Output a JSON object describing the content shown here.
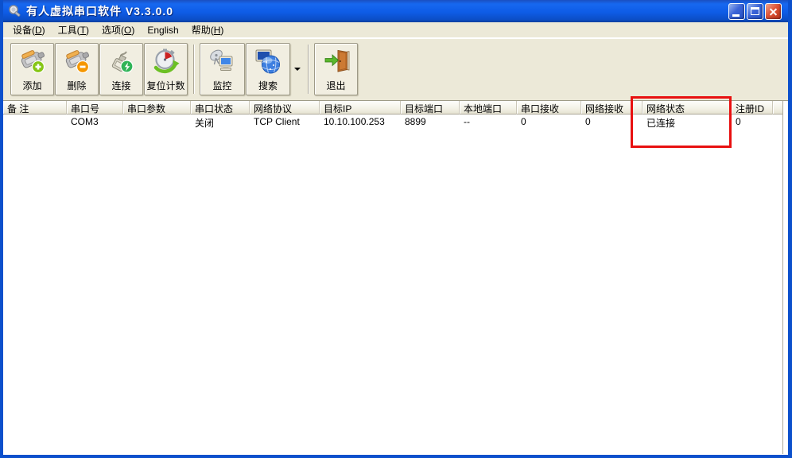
{
  "window": {
    "title": "有人虚拟串口软件 V3.3.0.0"
  },
  "menu": {
    "items": [
      {
        "pre": "设备(",
        "key": "D",
        "post": ")"
      },
      {
        "pre": "工具(",
        "key": "T",
        "post": ")"
      },
      {
        "pre": "选项(",
        "key": "O",
        "post": ")"
      },
      {
        "pre": "English",
        "key": "",
        "post": ""
      },
      {
        "pre": "帮助(",
        "key": "H",
        "post": ")"
      }
    ]
  },
  "toolbar": {
    "buttons": [
      {
        "label": "添加",
        "icon": "serial-port-add-icon"
      },
      {
        "label": "删除",
        "icon": "serial-port-remove-icon"
      },
      {
        "label": "连接",
        "icon": "connect-icon"
      },
      {
        "label": "复位计数",
        "icon": "reset-counter-icon"
      },
      {
        "label": "监控",
        "icon": "monitor-icon"
      },
      {
        "label": "搜索",
        "icon": "search-icon"
      },
      {
        "label": "退出",
        "icon": "exit-icon"
      }
    ]
  },
  "table": {
    "columns": [
      {
        "label": "备 注",
        "value": ""
      },
      {
        "label": "串口号",
        "value": "COM3"
      },
      {
        "label": "串口参数",
        "value": ""
      },
      {
        "label": "串口状态",
        "value": "关闭"
      },
      {
        "label": "网络协议",
        "value": "TCP Client"
      },
      {
        "label": "目标IP",
        "value": "10.10.100.253"
      },
      {
        "label": "目标端口",
        "value": "8899"
      },
      {
        "label": "本地端口",
        "value": "--"
      },
      {
        "label": "串口接收",
        "value": "0"
      },
      {
        "label": "网络接收",
        "value": "0"
      },
      {
        "label": "网络状态",
        "value": "已连接"
      },
      {
        "label": "注册ID",
        "value": "0"
      }
    ]
  },
  "annotation": {
    "highlight_color": "#e81010",
    "highlighted_column": "网络状态",
    "highlighted_value": "已连接"
  }
}
